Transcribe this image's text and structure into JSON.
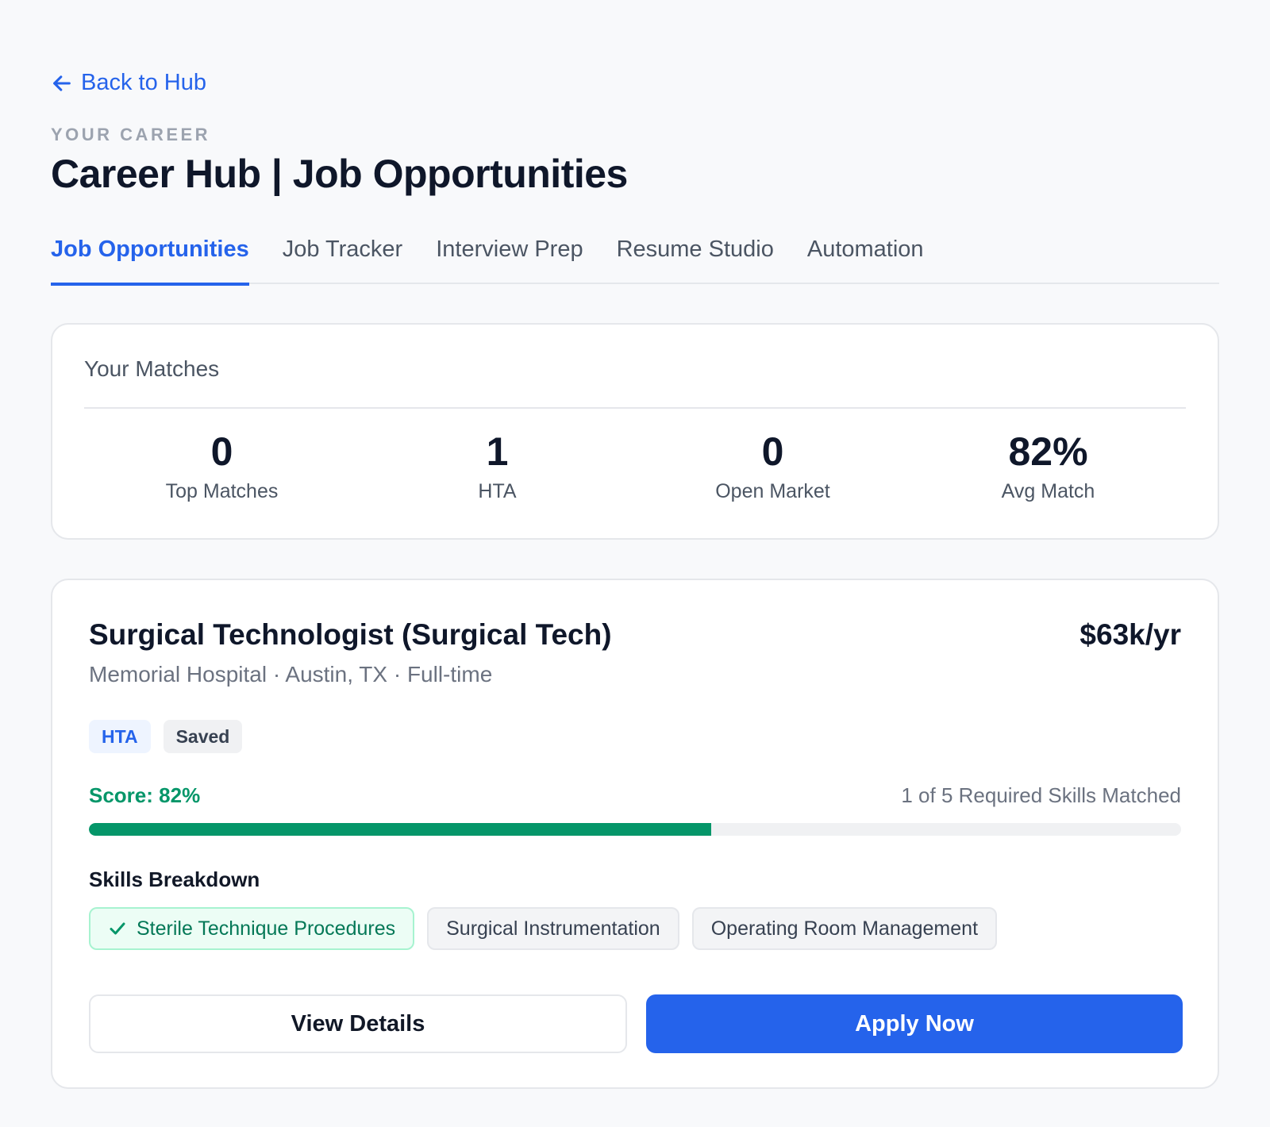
{
  "nav": {
    "back_label": "Back to Hub",
    "back_icon": "arrow-left-icon"
  },
  "header": {
    "eyebrow": "YOUR CAREER",
    "title": "Career Hub | Job Opportunities"
  },
  "tabs": [
    {
      "label": "Job Opportunities",
      "active": true
    },
    {
      "label": "Job Tracker",
      "active": false
    },
    {
      "label": "Interview Prep",
      "active": false
    },
    {
      "label": "Resume Studio",
      "active": false
    },
    {
      "label": "Automation",
      "active": false
    }
  ],
  "matches": {
    "title": "Your Matches",
    "stats": [
      {
        "value": "0",
        "label": "Top Matches"
      },
      {
        "value": "1",
        "label": "HTA"
      },
      {
        "value": "0",
        "label": "Open Market"
      },
      {
        "value": "82%",
        "label": "Avg Match"
      }
    ]
  },
  "job": {
    "title": "Surgical Technologist (Surgical Tech)",
    "salary": "$63k/yr",
    "meta": "Memorial Hospital · Austin, TX · Full-time",
    "tags": [
      "HTA",
      "Saved"
    ],
    "score_label": "Score: 82%",
    "score_bar_fraction": 0.57,
    "skills_matched_label": "1 of 5 Required Skills Matched",
    "breakdown_title": "Skills Breakdown",
    "skills": [
      {
        "label": "Sterile Technique Procedures",
        "matched": true
      },
      {
        "label": "Surgical Instrumentation",
        "matched": false
      },
      {
        "label": "Operating Room Management",
        "matched": false
      }
    ],
    "view_details_label": "View Details",
    "apply_label": "Apply Now"
  },
  "colors": {
    "accent": "#2563eb",
    "success": "#059669",
    "text": "#0f172a",
    "muted": "#6b7280"
  }
}
